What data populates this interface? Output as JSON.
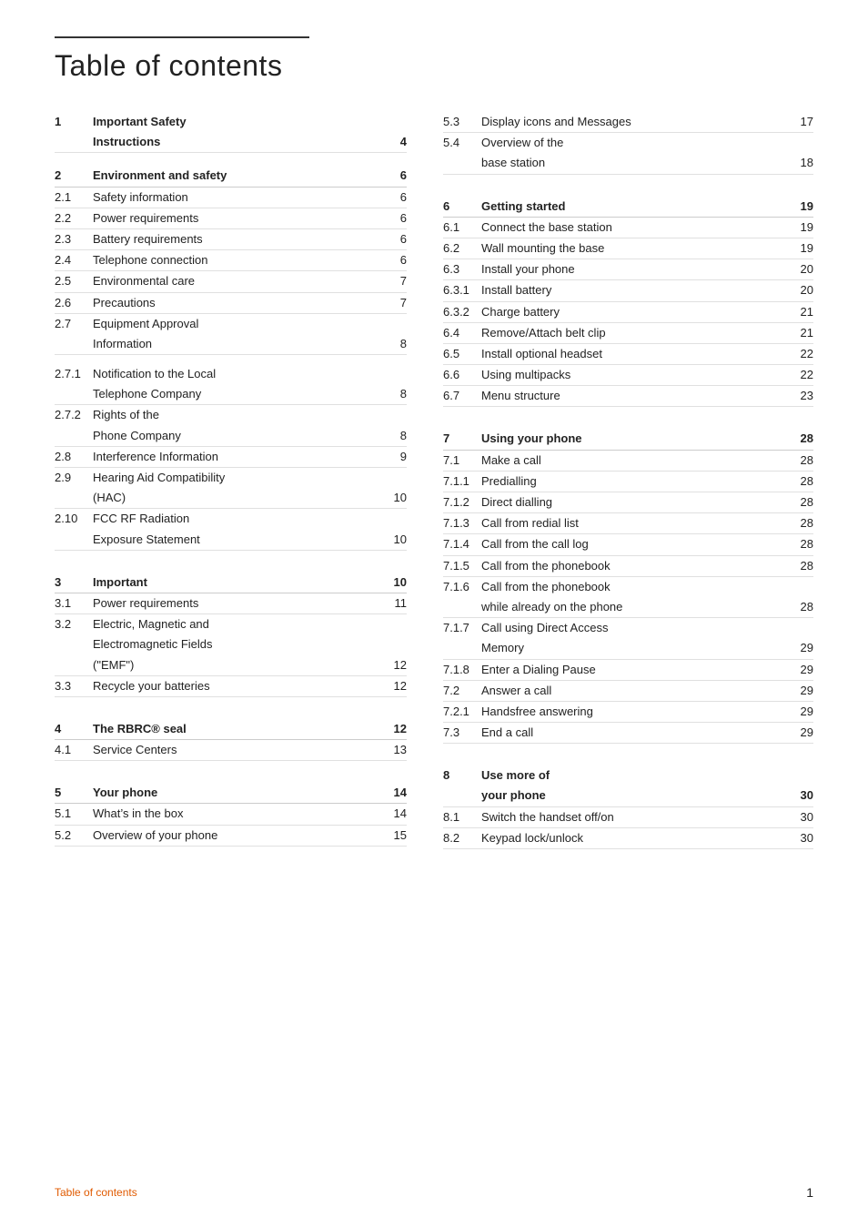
{
  "page": {
    "title": "Table of contents",
    "footer_label": "Table of contents",
    "footer_page": "1"
  },
  "left_column": [
    {
      "num": "1",
      "label": "Important Safety\nInstructions",
      "page": "4",
      "bold": true,
      "extra_margin": true
    },
    {
      "num": "2",
      "label": "Environment and safety",
      "page": "6",
      "bold": true
    },
    {
      "num": "2.1",
      "label": "Safety information",
      "page": "6",
      "bold": false
    },
    {
      "num": "2.2",
      "label": "Power requirements",
      "page": "6",
      "bold": false
    },
    {
      "num": "2.3",
      "label": "Battery requirements",
      "page": "6",
      "bold": false
    },
    {
      "num": "2.4",
      "label": "Telephone connection",
      "page": "6",
      "bold": false
    },
    {
      "num": "2.5",
      "label": "Environmental care",
      "page": "7",
      "bold": false
    },
    {
      "num": "2.6",
      "label": "Precautions",
      "page": "7",
      "bold": false
    },
    {
      "num": "2.7",
      "label": "Equipment Approval\nInformation",
      "page": "8",
      "bold": false,
      "extra_margin": true
    },
    {
      "num": "2.7.1",
      "label": "Notification to the Local\nTelephone Company",
      "page": "8",
      "bold": false
    },
    {
      "num": "2.7.2",
      "label": "Rights of the\nPhone Company",
      "page": "8",
      "bold": false
    },
    {
      "num": "2.8",
      "label": "Interference Information",
      "page": "9",
      "bold": false
    },
    {
      "num": "2.9",
      "label": "Hearing Aid Compatibility\n(HAC)",
      "page": "10",
      "bold": false
    },
    {
      "num": "2.10",
      "label": "FCC RF Radiation\nExposure Statement",
      "page": "10",
      "bold": false,
      "extra_margin": true
    },
    {
      "num": "3",
      "label": "Important",
      "page": "10",
      "bold": true
    },
    {
      "num": "3.1",
      "label": "Power requirements",
      "page": "11",
      "bold": false
    },
    {
      "num": "3.2",
      "label": "Electric, Magnetic and\nElectromagnetic Fields\n(\"EMF\")",
      "page": "12",
      "bold": false
    },
    {
      "num": "3.3",
      "label": "Recycle your batteries",
      "page": "12",
      "bold": false,
      "extra_margin": true
    },
    {
      "num": "4",
      "label": "The RBRC® seal",
      "page": "12",
      "bold": true
    },
    {
      "num": "4.1",
      "label": "Service Centers",
      "page": "13",
      "bold": false,
      "extra_margin": true
    },
    {
      "num": "5",
      "label": "Your phone",
      "page": "14",
      "bold": true
    },
    {
      "num": "5.1",
      "label": "What’s in the box",
      "page": "14",
      "bold": false
    },
    {
      "num": "5.2",
      "label": "Overview of your phone",
      "page": "15",
      "bold": false
    }
  ],
  "right_column": [
    {
      "num": "5.3",
      "label": "Display icons and Messages",
      "page": "17",
      "bold": false
    },
    {
      "num": "5.4",
      "label": "Overview of the\nbase station",
      "page": "18",
      "bold": false,
      "extra_margin": true
    },
    {
      "num": "6",
      "label": "Getting started",
      "page": "19",
      "bold": true
    },
    {
      "num": "6.1",
      "label": "Connect the base station",
      "page": "19",
      "bold": false
    },
    {
      "num": "6.2",
      "label": "Wall mounting the base",
      "page": "19",
      "bold": false
    },
    {
      "num": "6.3",
      "label": "Install your phone",
      "page": "20",
      "bold": false
    },
    {
      "num": "6.3.1",
      "label": "Install battery",
      "page": "20",
      "bold": false
    },
    {
      "num": "6.3.2",
      "label": "Charge battery",
      "page": "21",
      "bold": false
    },
    {
      "num": "6.4",
      "label": "Remove/Attach belt clip",
      "page": "21",
      "bold": false
    },
    {
      "num": "6.5",
      "label": "Install optional headset",
      "page": "22",
      "bold": false
    },
    {
      "num": "6.6",
      "label": "Using multipacks",
      "page": "22",
      "bold": false
    },
    {
      "num": "6.7",
      "label": "Menu structure",
      "page": "23",
      "bold": false,
      "extra_margin": true
    },
    {
      "num": "7",
      "label": "Using your phone",
      "page": "28",
      "bold": true
    },
    {
      "num": "7.1",
      "label": "Make a call",
      "page": "28",
      "bold": false
    },
    {
      "num": "7.1.1",
      "label": "Predialling",
      "page": "28",
      "bold": false
    },
    {
      "num": "7.1.2",
      "label": "Direct dialling",
      "page": "28",
      "bold": false
    },
    {
      "num": "7.1.3",
      "label": "Call from redial list",
      "page": "28",
      "bold": false
    },
    {
      "num": "7.1.4",
      "label": "Call from the call log",
      "page": "28",
      "bold": false
    },
    {
      "num": "7.1.5",
      "label": "Call from the phonebook",
      "page": "28",
      "bold": false
    },
    {
      "num": "7.1.6",
      "label": "Call from the phonebook\nwhile already on the phone",
      "page": "28",
      "bold": false
    },
    {
      "num": "7.1.7",
      "label": "Call using Direct Access\nMemory",
      "page": "29",
      "bold": false
    },
    {
      "num": "7.1.8",
      "label": "Enter a Dialing Pause",
      "page": "29",
      "bold": false
    },
    {
      "num": "7.2",
      "label": "Answer a call",
      "page": "29",
      "bold": false
    },
    {
      "num": "7.2.1",
      "label": "Handsfree answering",
      "page": "29",
      "bold": false
    },
    {
      "num": "7.3",
      "label": "End a call",
      "page": "29",
      "bold": false,
      "extra_margin": true
    },
    {
      "num": "8",
      "label": "Use more of\nyour phone",
      "page": "30",
      "bold": true
    },
    {
      "num": "8.1",
      "label": "Switch the handset off/on",
      "page": "30",
      "bold": false
    },
    {
      "num": "8.2",
      "label": "Keypad lock/unlock",
      "page": "30",
      "bold": false
    }
  ]
}
